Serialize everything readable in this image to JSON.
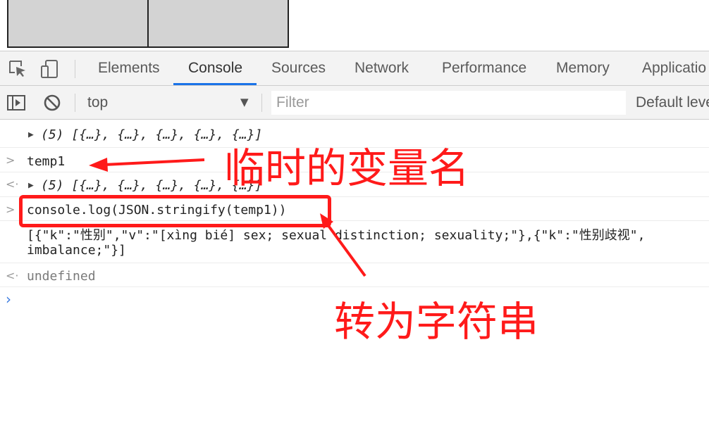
{
  "devtools": {
    "tabs": [
      {
        "label": "Elements",
        "active": false
      },
      {
        "label": "Console",
        "active": true
      },
      {
        "label": "Sources",
        "active": false
      },
      {
        "label": "Network",
        "active": false
      },
      {
        "label": "Performance",
        "active": false
      },
      {
        "label": "Memory",
        "active": false
      },
      {
        "label": "Applicatio",
        "active": false
      }
    ],
    "icons": [
      "inspect-element-icon",
      "device-toolbar-icon"
    ]
  },
  "console_toolbar": {
    "icons": [
      "show-sidebar-icon",
      "clear-console-icon"
    ],
    "context": "top",
    "filter_placeholder": "Filter",
    "levels_label": "Default leve"
  },
  "console": {
    "messages": [
      {
        "kind": "output",
        "text": "(5) [{…}, {…}, {…}, {…}, {…}]"
      },
      {
        "kind": "input",
        "text": "temp1"
      },
      {
        "kind": "result",
        "text": "(5) [{…}, {…}, {…}, {…}, {…}]"
      },
      {
        "kind": "input",
        "text": "console.log(JSON.stringify(temp1))"
      },
      {
        "kind": "log",
        "line1": "[{\"k\":\"性别\",\"v\":\"[xìng bié] sex; sexual distinction; sexuality;\"},{\"k\":\"性别歧视\",",
        "line2": "imbalance;\"}]"
      },
      {
        "kind": "result",
        "text": "undefined"
      }
    ]
  },
  "annotations": {
    "variable_name": "临时的变量名",
    "to_string": "转为字符串",
    "color": "#ff1a1a"
  }
}
